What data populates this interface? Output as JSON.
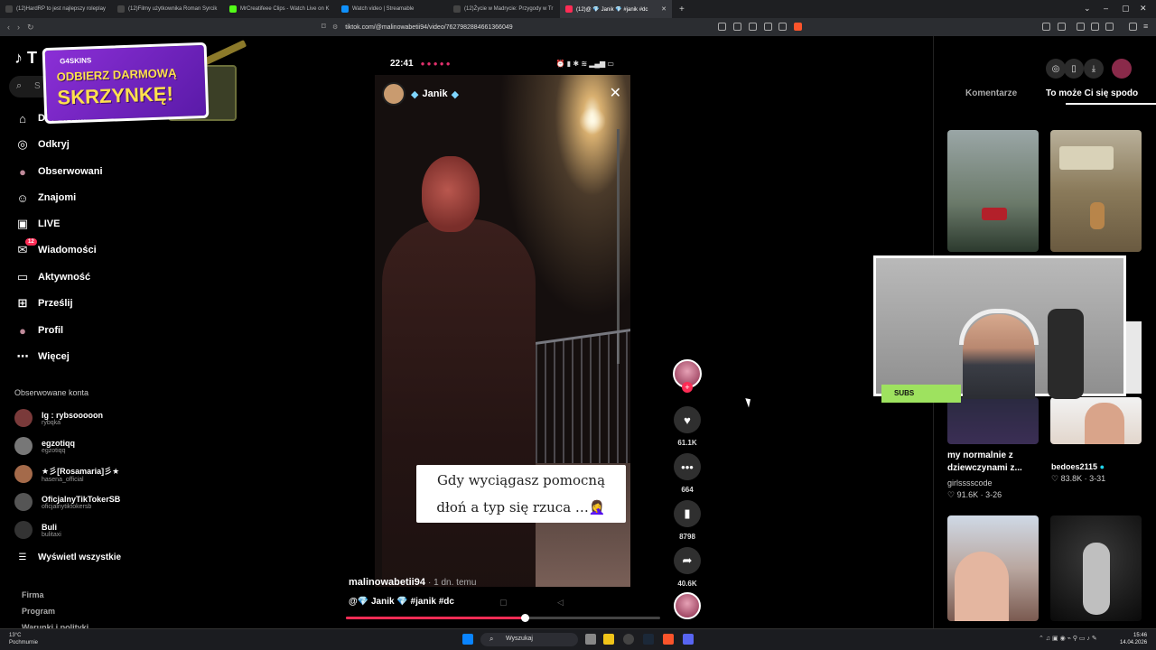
{
  "browser": {
    "tabs": [
      {
        "title": "(12)HardRP to jest najlepszy roleplay",
        "color": "#444"
      },
      {
        "title": "(12)Filmy użytkownika Roman Syrcik",
        "color": "#444"
      },
      {
        "title": "MrCreatifeee Clips - Watch Live on K",
        "color": "#53fc18"
      },
      {
        "title": "Watch video | Streamable",
        "color": "#0f90fa"
      },
      {
        "title": "(12)Życie w Madrycie: Przygody w Tr",
        "color": "#444"
      },
      {
        "title": "(12)@ 💎 Janik 💎 #janik #dc",
        "color": "#fe2c55"
      }
    ],
    "url": "tiktok.com/@malinowabetii94/video/7627982884661366049"
  },
  "promo": {
    "brand": "G4SKINS",
    "line1": "ODBIERZ DARMOWĄ",
    "line2": "SKRZYNKĘ!"
  },
  "sidebar": {
    "logo": "T",
    "search_placeholder": "S",
    "nav": [
      {
        "label": "Dla Ciebie",
        "icon": "home-icon"
      },
      {
        "label": "Odkryj",
        "icon": "compass-icon"
      },
      {
        "label": "Obserwowani",
        "icon": "following-icon"
      },
      {
        "label": "Znajomi",
        "icon": "friends-icon"
      },
      {
        "label": "LIVE",
        "icon": "live-icon"
      },
      {
        "label": "Wiadomości",
        "icon": "inbox-icon",
        "badge": "12"
      },
      {
        "label": "Aktywność",
        "icon": "activity-icon"
      },
      {
        "label": "Prześlij",
        "icon": "upload-icon"
      },
      {
        "label": "Profil",
        "icon": "profile-icon"
      },
      {
        "label": "Więcej",
        "icon": "more-icon"
      }
    ],
    "following_title": "Obserwowane konta",
    "accounts": [
      {
        "name": "Ig : rybsooooon",
        "handle": "rybqka",
        "color": "#7a3a3a"
      },
      {
        "name": "egzotiqq",
        "handle": "egzotiqq",
        "color": "#777"
      },
      {
        "name": "★彡[Rosamaria]彡★",
        "handle": "hasena_official",
        "color": "#a46a4a"
      },
      {
        "name": "OficjalnyTikTokerSB",
        "handle": "oficjalnytiktokersb",
        "color": "#555"
      },
      {
        "name": "Buli",
        "handle": "bulitaxi",
        "color": "#333"
      }
    ],
    "show_all": "Wyświetl wszystkie",
    "footer": [
      "Firma",
      "Program",
      "Warunki i polityki"
    ]
  },
  "video": {
    "status_time": "22:41",
    "username": "Janik",
    "caption": "Gdy wyciągasz pomocną dłoń a typ się rzuca …🤦‍♀️",
    "author": "malinowabetii94",
    "ago": "· 1 dn. temu",
    "tags": "@💎 Janik 💎 #janik #dc",
    "progress": 0.57
  },
  "actions": {
    "likes": "61.1K",
    "comments": "664",
    "saves": "8798",
    "shares": "40.6K"
  },
  "right_panel": {
    "tabs": [
      "Komentarze",
      "To może Ci się spodo"
    ],
    "items": [
      {
        "caption": "my normalnie z dziewczynami z...",
        "user": "girlsssscode",
        "stats": "♡ 91.6K · 3-26"
      },
      {
        "caption": "",
        "user": "bedoes2115",
        "stats": "♡ 83.8K · 3-31"
      }
    ]
  },
  "webcam": {
    "label": "SUBS"
  },
  "taskbar": {
    "weather_temp": "13°C",
    "weather_desc": "Pochmurnie",
    "search": "Wyszukaj",
    "time": "15:46",
    "date": "14.04.2026"
  }
}
